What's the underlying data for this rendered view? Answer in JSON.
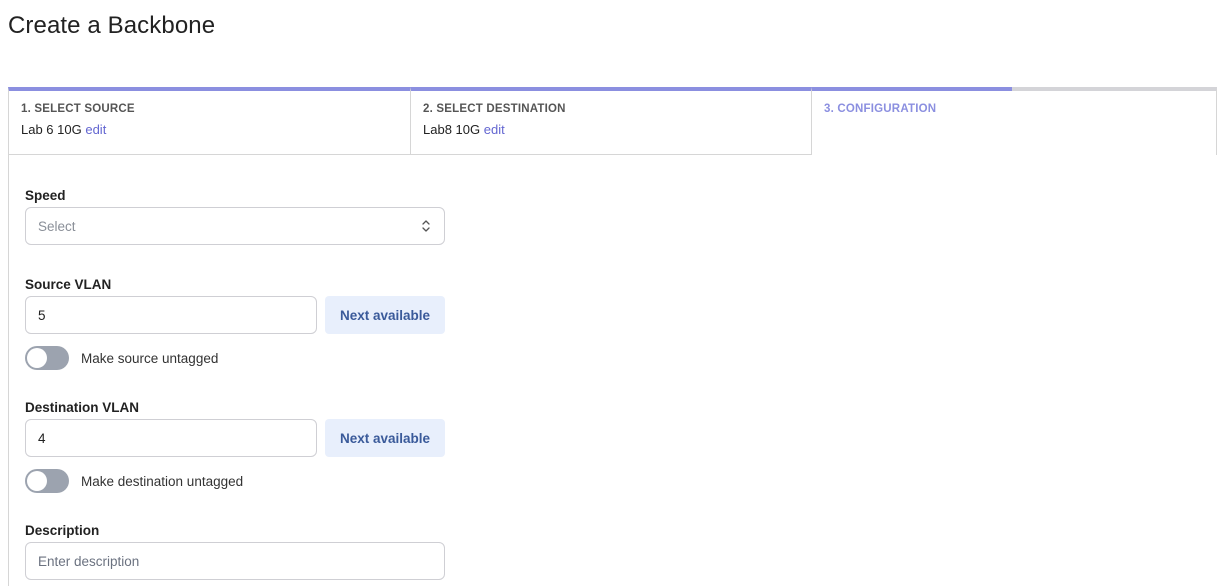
{
  "page": {
    "title": "Create a Backbone"
  },
  "steps": [
    {
      "heading": "1. SELECT SOURCE",
      "value": "Lab 6 10G",
      "edit_label": "edit"
    },
    {
      "heading": "2. SELECT DESTINATION",
      "value": "Lab8 10G",
      "edit_label": "edit"
    },
    {
      "heading": "3. CONFIGURATION"
    }
  ],
  "form": {
    "speed": {
      "label": "Speed",
      "placeholder": "Select"
    },
    "source_vlan": {
      "label": "Source VLAN",
      "value": "5",
      "next_label": "Next available",
      "toggle_label": "Make source untagged"
    },
    "destination_vlan": {
      "label": "Destination VLAN",
      "value": "4",
      "next_label": "Next available",
      "toggle_label": "Make destination untagged"
    },
    "description": {
      "label": "Description",
      "placeholder": "Enter description"
    }
  },
  "colors": {
    "accent": "#8b8fe0",
    "link": "#6366d1",
    "button_bg": "#e8effc"
  },
  "icons": {
    "select_chevron": "chevron-up-down-icon"
  }
}
